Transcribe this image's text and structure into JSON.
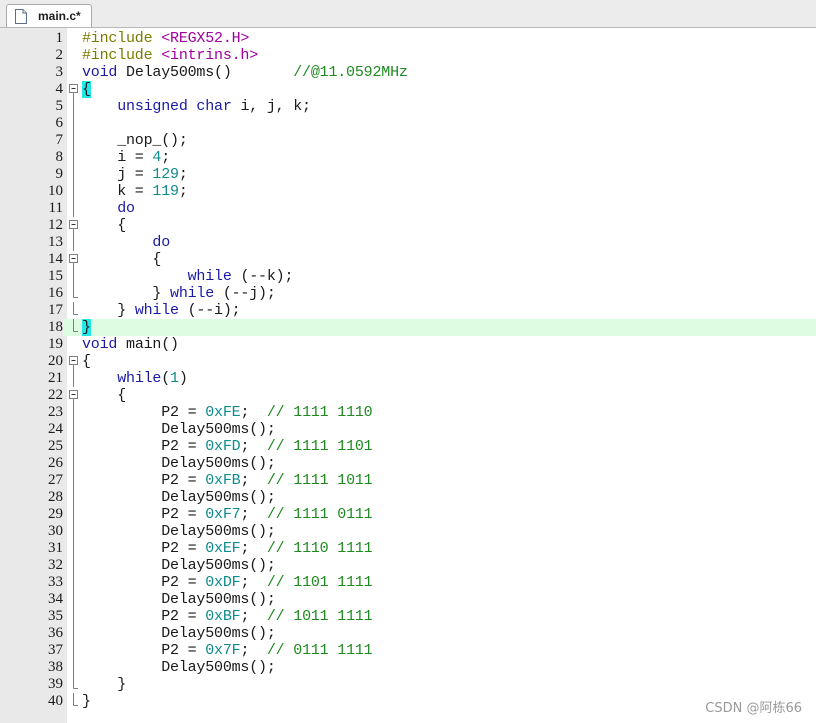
{
  "tab": {
    "label": "main.c*",
    "icon": "c-file-icon"
  },
  "watermark": "CSDN @阿栋66",
  "colors": {
    "keyword": "#1a1aa6",
    "preprocessor": "#7b7b00",
    "include_path": "#a000a0",
    "number": "#0f8b8b",
    "comment": "#1f8a1f",
    "current_line": "#ddfde3",
    "brace_match": "#22e7e7"
  },
  "lines": [
    {
      "n": "1",
      "fold": "",
      "tokens": [
        {
          "t": "pp",
          "v": "#include "
        },
        {
          "t": "inc",
          "v": "<REGX52.H>"
        }
      ]
    },
    {
      "n": "2",
      "fold": "",
      "tokens": [
        {
          "t": "pp",
          "v": "#include "
        },
        {
          "t": "inc",
          "v": "<intrins.h>"
        }
      ]
    },
    {
      "n": "3",
      "fold": "",
      "tokens": [
        {
          "t": "kw",
          "v": "void"
        },
        {
          "t": "p",
          "v": " Delay500ms()       "
        },
        {
          "t": "cm",
          "v": "//@11.0592MHz"
        }
      ]
    },
    {
      "n": "4",
      "fold": "open",
      "tokens": [
        {
          "t": "brhl",
          "v": "{"
        }
      ]
    },
    {
      "n": "5",
      "fold": "line",
      "tokens": [
        {
          "t": "p",
          "v": "    "
        },
        {
          "t": "kw",
          "v": "unsigned char"
        },
        {
          "t": "p",
          "v": " i, j, k;"
        }
      ]
    },
    {
      "n": "6",
      "fold": "line",
      "tokens": []
    },
    {
      "n": "7",
      "fold": "line",
      "tokens": [
        {
          "t": "p",
          "v": "    _nop_();"
        }
      ]
    },
    {
      "n": "8",
      "fold": "line",
      "tokens": [
        {
          "t": "p",
          "v": "    i = "
        },
        {
          "t": "num",
          "v": "4"
        },
        {
          "t": "p",
          "v": ";"
        }
      ]
    },
    {
      "n": "9",
      "fold": "line",
      "tokens": [
        {
          "t": "p",
          "v": "    j = "
        },
        {
          "t": "num",
          "v": "129"
        },
        {
          "t": "p",
          "v": ";"
        }
      ]
    },
    {
      "n": "10",
      "fold": "line",
      "tokens": [
        {
          "t": "p",
          "v": "    k = "
        },
        {
          "t": "num",
          "v": "119"
        },
        {
          "t": "p",
          "v": ";"
        }
      ]
    },
    {
      "n": "11",
      "fold": "line",
      "tokens": [
        {
          "t": "p",
          "v": "    "
        },
        {
          "t": "kw",
          "v": "do"
        }
      ]
    },
    {
      "n": "12",
      "fold": "open",
      "tokens": [
        {
          "t": "p",
          "v": "    {"
        }
      ]
    },
    {
      "n": "13",
      "fold": "line",
      "tokens": [
        {
          "t": "p",
          "v": "        "
        },
        {
          "t": "kw",
          "v": "do"
        }
      ]
    },
    {
      "n": "14",
      "fold": "open",
      "tokens": [
        {
          "t": "p",
          "v": "        {"
        }
      ]
    },
    {
      "n": "15",
      "fold": "line",
      "tokens": [
        {
          "t": "p",
          "v": "            "
        },
        {
          "t": "kw",
          "v": "while"
        },
        {
          "t": "p",
          "v": " (--k);"
        }
      ]
    },
    {
      "n": "16",
      "fold": "end",
      "tokens": [
        {
          "t": "p",
          "v": "        } "
        },
        {
          "t": "kw",
          "v": "while"
        },
        {
          "t": "p",
          "v": " (--j);"
        }
      ]
    },
    {
      "n": "17",
      "fold": "end",
      "tokens": [
        {
          "t": "p",
          "v": "    } "
        },
        {
          "t": "kw",
          "v": "while"
        },
        {
          "t": "p",
          "v": " (--i);"
        }
      ]
    },
    {
      "n": "18",
      "fold": "end",
      "current": true,
      "tokens": [
        {
          "t": "brhl",
          "v": "}"
        }
      ]
    },
    {
      "n": "19",
      "fold": "",
      "tokens": [
        {
          "t": "kw",
          "v": "void"
        },
        {
          "t": "p",
          "v": " main()"
        }
      ]
    },
    {
      "n": "20",
      "fold": "open",
      "tokens": [
        {
          "t": "p",
          "v": "{"
        }
      ]
    },
    {
      "n": "21",
      "fold": "line",
      "tokens": [
        {
          "t": "p",
          "v": "    "
        },
        {
          "t": "kw",
          "v": "while"
        },
        {
          "t": "p",
          "v": "("
        },
        {
          "t": "num",
          "v": "1"
        },
        {
          "t": "p",
          "v": ")"
        }
      ]
    },
    {
      "n": "22",
      "fold": "open",
      "tokens": [
        {
          "t": "p",
          "v": "    {"
        }
      ]
    },
    {
      "n": "23",
      "fold": "line",
      "tokens": [
        {
          "t": "p",
          "v": "         P2 = "
        },
        {
          "t": "num",
          "v": "0xFE"
        },
        {
          "t": "p",
          "v": ";  "
        },
        {
          "t": "cm",
          "v": "// 1111 1110"
        }
      ]
    },
    {
      "n": "24",
      "fold": "line",
      "tokens": [
        {
          "t": "p",
          "v": "         Delay500ms();"
        }
      ]
    },
    {
      "n": "25",
      "fold": "line",
      "tokens": [
        {
          "t": "p",
          "v": "         P2 = "
        },
        {
          "t": "num",
          "v": "0xFD"
        },
        {
          "t": "p",
          "v": ";  "
        },
        {
          "t": "cm",
          "v": "// 1111 1101"
        }
      ]
    },
    {
      "n": "26",
      "fold": "line",
      "tokens": [
        {
          "t": "p",
          "v": "         Delay500ms();"
        }
      ]
    },
    {
      "n": "27",
      "fold": "line",
      "tokens": [
        {
          "t": "p",
          "v": "         P2 = "
        },
        {
          "t": "num",
          "v": "0xFB"
        },
        {
          "t": "p",
          "v": ";  "
        },
        {
          "t": "cm",
          "v": "// 1111 1011"
        }
      ]
    },
    {
      "n": "28",
      "fold": "line",
      "tokens": [
        {
          "t": "p",
          "v": "         Delay500ms();"
        }
      ]
    },
    {
      "n": "29",
      "fold": "line",
      "tokens": [
        {
          "t": "p",
          "v": "         P2 = "
        },
        {
          "t": "num",
          "v": "0xF7"
        },
        {
          "t": "p",
          "v": ";  "
        },
        {
          "t": "cm",
          "v": "// 1111 0111"
        }
      ]
    },
    {
      "n": "30",
      "fold": "line",
      "tokens": [
        {
          "t": "p",
          "v": "         Delay500ms();"
        }
      ]
    },
    {
      "n": "31",
      "fold": "line",
      "tokens": [
        {
          "t": "p",
          "v": "         P2 = "
        },
        {
          "t": "num",
          "v": "0xEF"
        },
        {
          "t": "p",
          "v": ";  "
        },
        {
          "t": "cm",
          "v": "// 1110 1111"
        }
      ]
    },
    {
      "n": "32",
      "fold": "line",
      "tokens": [
        {
          "t": "p",
          "v": "         Delay500ms();"
        }
      ]
    },
    {
      "n": "33",
      "fold": "line",
      "tokens": [
        {
          "t": "p",
          "v": "         P2 = "
        },
        {
          "t": "num",
          "v": "0xDF"
        },
        {
          "t": "p",
          "v": ";  "
        },
        {
          "t": "cm",
          "v": "// 1101 1111"
        }
      ]
    },
    {
      "n": "34",
      "fold": "line",
      "tokens": [
        {
          "t": "p",
          "v": "         Delay500ms();"
        }
      ]
    },
    {
      "n": "35",
      "fold": "line",
      "tokens": [
        {
          "t": "p",
          "v": "         P2 = "
        },
        {
          "t": "num",
          "v": "0xBF"
        },
        {
          "t": "p",
          "v": ";  "
        },
        {
          "t": "cm",
          "v": "// 1011 1111"
        }
      ]
    },
    {
      "n": "36",
      "fold": "line",
      "tokens": [
        {
          "t": "p",
          "v": "         Delay500ms();"
        }
      ]
    },
    {
      "n": "37",
      "fold": "line",
      "tokens": [
        {
          "t": "p",
          "v": "         P2 = "
        },
        {
          "t": "num",
          "v": "0x7F"
        },
        {
          "t": "p",
          "v": ";  "
        },
        {
          "t": "cm",
          "v": "// 0111 1111"
        }
      ]
    },
    {
      "n": "38",
      "fold": "line",
      "tokens": [
        {
          "t": "p",
          "v": "         Delay500ms();"
        }
      ]
    },
    {
      "n": "39",
      "fold": "end",
      "tokens": [
        {
          "t": "p",
          "v": "    }"
        }
      ]
    },
    {
      "n": "40",
      "fold": "end",
      "tokens": [
        {
          "t": "p",
          "v": "}"
        }
      ]
    }
  ]
}
